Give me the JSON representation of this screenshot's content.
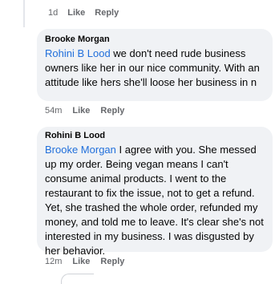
{
  "top_actions": {
    "time": "1d",
    "like": "Like",
    "reply": "Reply"
  },
  "comments": [
    {
      "author": "Brooke Morgan",
      "mention": "Rohini B Lood",
      "text": " we don't need rude business owners like her in our nice community. With an attitude like hers she'll loose her business in n",
      "time": "54m",
      "like": "Like",
      "reply": "Reply"
    },
    {
      "author": "Rohini B Lood",
      "mention": "Brooke Morgan",
      "text": " I agree with you. She messed up my order. Being vegan means I can't consume animal products. I went to the restaurant to fix the issue, not to get a refund. Yet, she trashed the whole order, refunded my money, and told me to leave. It's clear she's not interested in my business. I was disgusted by her behavior.",
      "time": "12m",
      "like": "Like",
      "reply": "Reply"
    }
  ],
  "colors": {
    "mention": "#216fdb",
    "bubble": "#f0f2f5",
    "meta": "#65676b"
  },
  "icons": {
    "avatar_1": "avatar-brooke",
    "avatar_2": "avatar-rohini"
  }
}
